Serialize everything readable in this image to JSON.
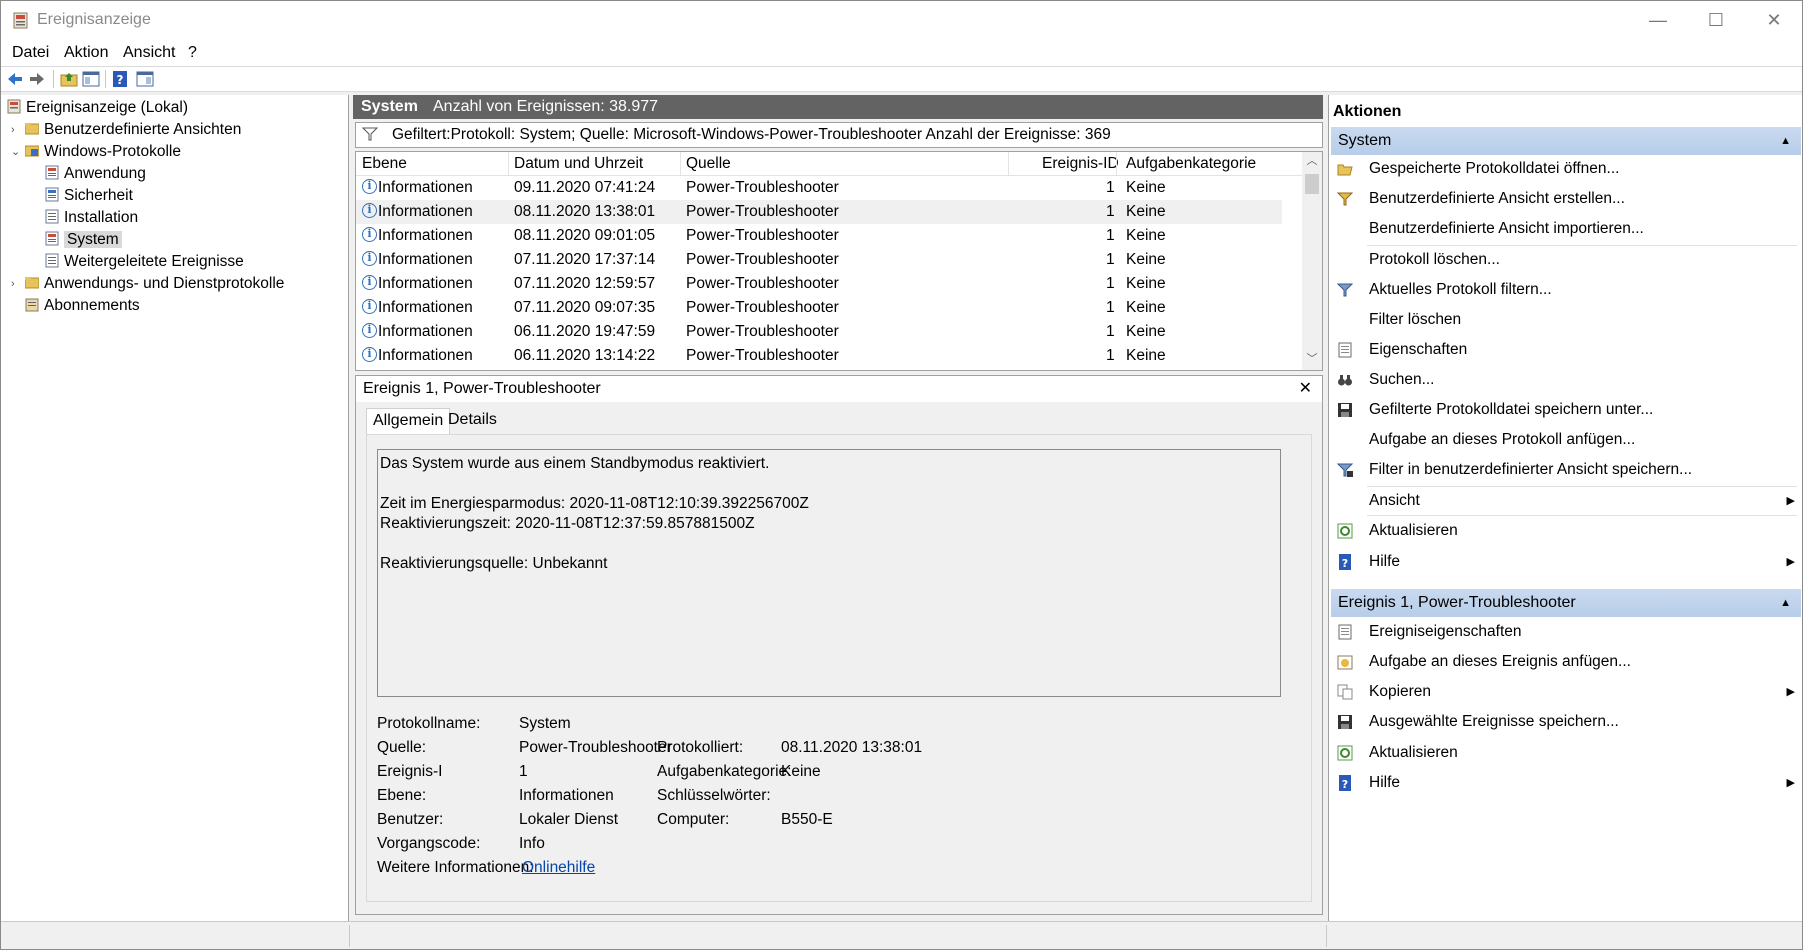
{
  "window": {
    "title": "Ereignisanzeige",
    "controls": [
      "—",
      "☐",
      "✕"
    ]
  },
  "menu": [
    "Datei",
    "Aktion",
    "Ansicht",
    "?"
  ],
  "tree": {
    "items": [
      {
        "label": "Ereignisanzeige (Lokal)",
        "icon": "event-viewer-icon"
      },
      {
        "label": "Benutzerdefinierte Ansichten",
        "icon": "folder-icon"
      },
      {
        "label": "Windows-Protokolle",
        "icon": "folder-icon"
      },
      {
        "label": "Anwendung",
        "icon": "log-icon"
      },
      {
        "label": "Sicherheit",
        "icon": "log-icon"
      },
      {
        "label": "Installation",
        "icon": "log-icon"
      },
      {
        "label": "System",
        "icon": "log-icon"
      },
      {
        "label": "Weitergeleitete Ereignisse",
        "icon": "log-icon"
      },
      {
        "label": "Anwendungs- und Dienstprotokolle",
        "icon": "folder-icon"
      },
      {
        "label": "Abonnements",
        "icon": "subscription-icon"
      }
    ]
  },
  "center": {
    "header_title": "System",
    "header_count": "Anzahl von Ereignissen: 38.977",
    "filter_text": "Gefiltert:Protokoll: System; Quelle: Microsoft-Windows-Power-Troubleshooter Anzahl der Ereignisse: 369"
  },
  "grid": {
    "columns": [
      "Ebene",
      "Datum und Uhrzeit",
      "Quelle",
      "Ereignis-ID",
      "Aufgabenkategorie"
    ],
    "rows": [
      {
        "level": "Informationen",
        "date": "09.11.2020 07:41:24",
        "source": "Power-Troubleshooter",
        "id": "1",
        "category": "Keine"
      },
      {
        "level": "Informationen",
        "date": "08.11.2020 13:38:01",
        "source": "Power-Troubleshooter",
        "id": "1",
        "category": "Keine"
      },
      {
        "level": "Informationen",
        "date": "08.11.2020 09:01:05",
        "source": "Power-Troubleshooter",
        "id": "1",
        "category": "Keine"
      },
      {
        "level": "Informationen",
        "date": "07.11.2020 17:37:14",
        "source": "Power-Troubleshooter",
        "id": "1",
        "category": "Keine"
      },
      {
        "level": "Informationen",
        "date": "07.11.2020 12:59:57",
        "source": "Power-Troubleshooter",
        "id": "1",
        "category": "Keine"
      },
      {
        "level": "Informationen",
        "date": "07.11.2020 09:07:35",
        "source": "Power-Troubleshooter",
        "id": "1",
        "category": "Keine"
      },
      {
        "level": "Informationen",
        "date": "06.11.2020 19:47:59",
        "source": "Power-Troubleshooter",
        "id": "1",
        "category": "Keine"
      },
      {
        "level": "Informationen",
        "date": "06.11.2020 13:14:22",
        "source": "Power-Troubleshooter",
        "id": "1",
        "category": "Keine"
      }
    ]
  },
  "detail": {
    "title": "Ereignis 1, Power-Troubleshooter",
    "close": "✕",
    "tabs": [
      "Allgemein",
      "Details"
    ],
    "message": [
      "Das System wurde aus einem Standbymodus reaktiviert.",
      "",
      "Zeit im Energiesparmodus: 2020-11-08T12:10:39.392256700Z",
      "Reaktivierungszeit: 2020-11-08T12:37:59.857881500Z",
      "",
      "Reaktivierungsquelle: Unbekannt"
    ],
    "props": {
      "protokollname_label": "Protokollname:",
      "protokollname": "System",
      "quelle_label": "Quelle:",
      "quelle": "Power-Troubleshooter",
      "protokolliert_label": "Protokolliert:",
      "protokolliert": "08.11.2020 13:38:01",
      "ereignis_label": "Ereignis-I",
      "ereignis": "1",
      "aufgabe_label": "Aufgabenkategorie:",
      "aufgabe": "Keine",
      "ebene_label": "Ebene:",
      "ebene": "Informationen",
      "schluessel_label": "Schlüsselwörter:",
      "schluessel": "",
      "benutzer_label": "Benutzer:",
      "benutzer": "Lokaler Dienst",
      "computer_label": "Computer:",
      "computer": "B550-E",
      "vorgang_label": "Vorgangscode:",
      "vorgang": "Info",
      "weitere_label": "Weitere Informationen:",
      "weitere_link": "Onlinehilfe"
    }
  },
  "actions": {
    "title": "Aktionen",
    "section1": "System",
    "items1": [
      {
        "label": "Gespeicherte Protokolldatei öffnen...",
        "icon": "open-folder-icon",
        "sub": false
      },
      {
        "label": "Benutzerdefinierte Ansicht erstellen...",
        "icon": "filter-create-icon",
        "sub": false
      },
      {
        "label": "Benutzerdefinierte Ansicht importieren...",
        "icon": "",
        "sub": false
      },
      {
        "label": "Protokoll löschen...",
        "icon": "",
        "sub": false
      },
      {
        "label": "Aktuelles Protokoll filtern...",
        "icon": "filter-icon",
        "sub": false
      },
      {
        "label": "Filter löschen",
        "icon": "",
        "sub": false
      },
      {
        "label": "Eigenschaften",
        "icon": "properties-icon",
        "sub": false
      },
      {
        "label": "Suchen...",
        "icon": "binoculars-icon",
        "sub": false
      },
      {
        "label": "Gefilterte Protokolldatei speichern unter...",
        "icon": "save-icon",
        "sub": false
      },
      {
        "label": "Aufgabe an dieses Protokoll anfügen...",
        "icon": "",
        "sub": false
      },
      {
        "label": "Filter in benutzerdefinierter Ansicht speichern...",
        "icon": "filter-save-icon",
        "sub": false
      },
      {
        "label": "Ansicht",
        "icon": "",
        "sub": true
      },
      {
        "label": "Aktualisieren",
        "icon": "refresh-icon",
        "sub": false
      },
      {
        "label": "Hilfe",
        "icon": "help-icon",
        "sub": true
      }
    ],
    "section2": "Ereignis 1, Power-Troubleshooter",
    "items2": [
      {
        "label": "Ereigniseigenschaften",
        "icon": "properties-icon",
        "sub": false
      },
      {
        "label": "Aufgabe an dieses Ereignis anfügen...",
        "icon": "task-icon",
        "sub": false
      },
      {
        "label": "Kopieren",
        "icon": "copy-icon",
        "sub": true
      },
      {
        "label": "Ausgewählte Ereignisse speichern...",
        "icon": "save-icon",
        "sub": false
      },
      {
        "label": "Aktualisieren",
        "icon": "refresh-icon",
        "sub": false
      },
      {
        "label": "Hilfe",
        "icon": "help-icon",
        "sub": true
      }
    ]
  },
  "colors": {
    "accent_blue": "#2d6fc1",
    "section_bg": "#c4d6ee",
    "header_dark": "#636363",
    "link": "#0645ad"
  }
}
